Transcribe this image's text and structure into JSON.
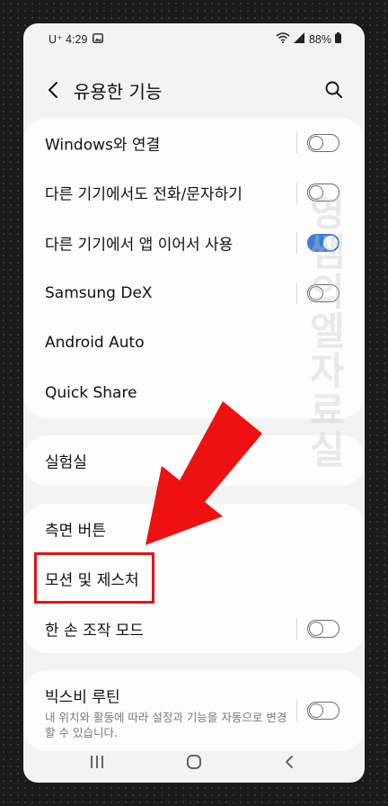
{
  "status": {
    "carrier_time": "U⁺ 4:29",
    "battery": "88%"
  },
  "header": {
    "title": "유용한 기능"
  },
  "group1": [
    {
      "label": "Windows와 연결",
      "toggle": false
    },
    {
      "label": "다른 기기에서도 전화/문자하기",
      "toggle": false
    },
    {
      "label": "다른 기기에서 앱 이어서 사용",
      "toggle": true
    },
    {
      "label": "Samsung DeX",
      "toggle": false
    },
    {
      "label": "Android Auto"
    },
    {
      "label": "Quick Share"
    }
  ],
  "group2": [
    {
      "label": "실험실"
    }
  ],
  "group3": [
    {
      "label": "측면 버튼"
    },
    {
      "label": "모션 및 제스처"
    },
    {
      "label": "한 손 조작 모드",
      "toggle": false
    }
  ],
  "group4": [
    {
      "label": "빅스비 루틴",
      "sub": "내 위치와 활동에 따라 설정과 기능을 자동으로 변경할 수 있습니다.",
      "toggle": false
    }
  ],
  "colors": {
    "accent": "#3e7bd8",
    "highlight": "#e01515"
  },
  "icons": [
    "image-icon",
    "wifi-icon",
    "signal-icon",
    "battery-icon",
    "back-arrow-icon",
    "search-icon",
    "recents-icon",
    "home-icon",
    "back-nav-icon"
  ]
}
